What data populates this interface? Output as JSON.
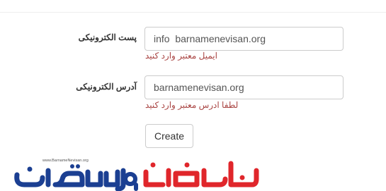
{
  "form": {
    "email": {
      "label": "پست الکترونیکی",
      "value": "info  barnamenevisan.org",
      "error": "ایمیل معتبر وارد کنید"
    },
    "address": {
      "label": "آدرس الکترونیکی",
      "value": "barnamenevisan.org",
      "error": "لطفا ادرس معتبر وارد کنید"
    },
    "submit_label": "Create"
  },
  "watermark": {
    "url": "www.BarnameNevisan.org",
    "colors": {
      "blue": "#1b3f92",
      "red": "#e0262b"
    }
  }
}
